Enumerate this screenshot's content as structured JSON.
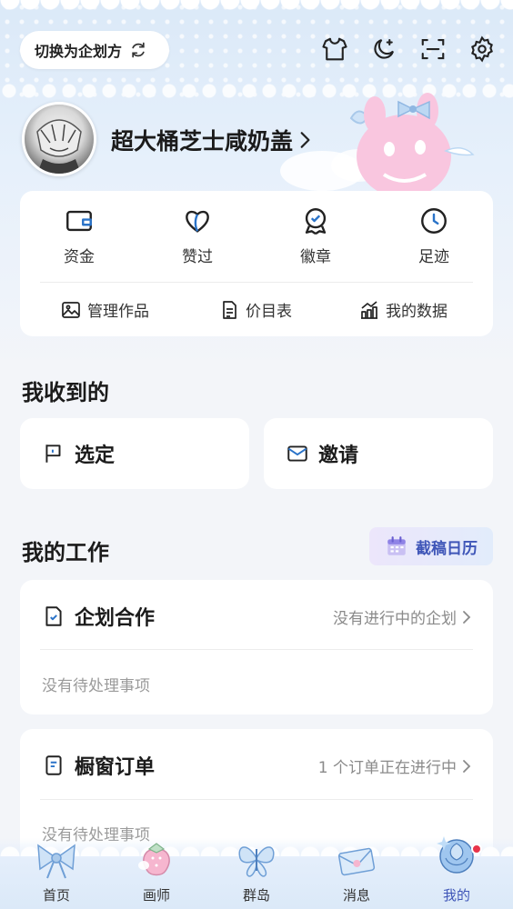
{
  "header": {
    "switch_label": "切换为企划方",
    "username": "超大桶芝士咸奶盖"
  },
  "stats": [
    {
      "label": "资金",
      "icon": "wallet-icon"
    },
    {
      "label": "赞过",
      "icon": "heart-icon"
    },
    {
      "label": "徽章",
      "icon": "medal-icon"
    },
    {
      "label": "足迹",
      "icon": "clock-icon"
    }
  ],
  "tools": [
    {
      "label": "管理作品",
      "icon": "image-icon"
    },
    {
      "label": "价目表",
      "icon": "price-list-icon"
    },
    {
      "label": "我的数据",
      "icon": "chart-icon"
    }
  ],
  "received": {
    "title": "我收到的",
    "items": [
      {
        "label": "选定",
        "icon": "flag-icon"
      },
      {
        "label": "邀请",
        "icon": "envelope-icon"
      }
    ]
  },
  "work": {
    "title": "我的工作",
    "calendar_label": "截稿日历",
    "cards": [
      {
        "title": "企划合作",
        "status": "没有进行中的企划",
        "empty": "没有待处理事项"
      },
      {
        "title": "橱窗订单",
        "status": "1 个订单正在进行中",
        "empty": "没有待处理事项"
      }
    ]
  },
  "nav": [
    {
      "label": "首页",
      "icon": "bow-icon"
    },
    {
      "label": "画师",
      "icon": "strawberry-icon"
    },
    {
      "label": "群岛",
      "icon": "butterfly-icon"
    },
    {
      "label": "消息",
      "icon": "letter-icon"
    },
    {
      "label": "我的",
      "icon": "rose-icon"
    }
  ],
  "colors": {
    "accent": "#3f56b8",
    "icon_blue": "#2a73c8",
    "badge_red": "#e8344a"
  }
}
